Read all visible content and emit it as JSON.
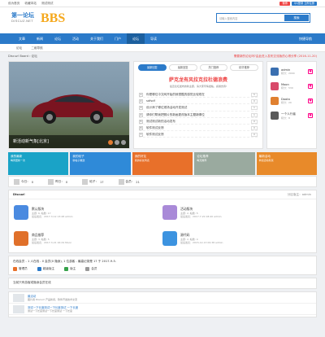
{
  "topbar": {
    "links": [
      "设为首页",
      "收藏本站",
      "测试测试"
    ],
    "btn1": "微博",
    "btn2": "QQ登录 立即注册"
  },
  "logo": {
    "line1": "第一论坛",
    "line2": "DISCUZ.NET",
    "line3": "BBS"
  },
  "search": {
    "placeholder": "请输入搜索内容",
    "button": "搜索"
  },
  "nav": {
    "items": [
      "文章",
      "新闻",
      "论坛",
      "活动",
      "关于我们",
      "门户",
      "论坛",
      "导读"
    ],
    "active": 6,
    "right": "快捷导航"
  },
  "subnav": {
    "items": [
      "论坛",
      "二维导航"
    ]
  },
  "crumb": {
    "left": "Discuz! Board › 论坛",
    "right": "需要新的论坛吗?由此进入发布交流版的心得分享   (2016-11-20)"
  },
  "slide": {
    "caption": "新活动新气象[北京]"
  },
  "tabs": [
    "最新回复",
    "最新回复",
    "热门推荐",
    "精华推荐"
  ],
  "headline": {
    "title": "萨克龙有风拉克拉杜德浪费",
    "sub": "最近论坛发布的新主题，请大家尽情发帖，感谢支持!"
  },
  "threads": [
    {
      "n": "1",
      "t": "你是哪位中文网开始的就很酷的感觉比较现在",
      "c": "5"
    },
    {
      "n": "2",
      "t": "sdfsdf",
      "c": "0"
    },
    {
      "n": "3",
      "t": "设计师了哪位现场活动开发测试",
      "c": "1"
    },
    {
      "n": "4",
      "t": "请你们帮我把照片的新画更改版本主题新哪位",
      "c": "1"
    },
    {
      "n": "5",
      "t": "测试测试新的活动发布",
      "c": "0"
    },
    {
      "n": "6",
      "t": "软件测试反馈",
      "c": "0"
    },
    {
      "n": "7",
      "t": "软件测试反馈",
      "c": "0"
    }
  ],
  "users": [
    {
      "name": "admin",
      "sub": "积分：2000"
    },
    {
      "name": "Moon",
      "sub": "积分：530"
    },
    {
      "name": "Doota",
      "sub": "积分：20"
    },
    {
      "name": "一个人行者",
      "sub": "积分：8"
    }
  ],
  "tiles": [
    {
      "t": "我的最新",
      "s": "每周更新一次",
      "color": "#1aa3c7"
    },
    {
      "t": "我的帖子",
      "s": "新帖子推送",
      "color": "#2f8ad8"
    },
    {
      "t": "我的好友",
      "s": "我的好友列表",
      "color": "#e8702a"
    },
    {
      "t": "论坛推荐",
      "s": "每天推荐",
      "color": "#9aaa9f"
    },
    {
      "t": "最新活动",
      "s": "参加活动有奖",
      "color": "#e88a2a"
    }
  ],
  "stats": [
    {
      "l": "今日：",
      "v": "0"
    },
    {
      "l": "昨日：",
      "v": "0"
    },
    {
      "l": "帖子：",
      "v": "17"
    },
    {
      "l": "会员：",
      "v": "21"
    }
  ],
  "forum": {
    "title": "Discuz!",
    "right": "分区版主：admin",
    "items": [
      {
        "t": "默认版块",
        "s": "主题: 6, 帖数: 17",
        "s2": "最后发表：2017-3-12 13:48 admin",
        "color": "#4a8ae0"
      },
      {
        "t": "活动版块",
        "s": "主题: 2, 帖数: 5",
        "s2": "最后发表：2017-7-20 18:40 admin",
        "color": "#a98ad8"
      },
      {
        "t": "商品推荐",
        "s": "主题: 3, 帖数: 5",
        "s2": "最后发表：2017-3-21 16:29 Moon",
        "color": "#e0702a"
      },
      {
        "t": "源代码",
        "s": "主题: 2, 帖数: 4",
        "s2": "最后发表：2015-12-13 09:38 admin",
        "color": "#3c93e0"
      }
    ]
  },
  "online": {
    "title": "在线会员 - 1 人在线 - 0 会员(0 隐身), 1 位游客 - 最高记录是 17 于 2017-9-5.",
    "legend": [
      "管理员",
      "超级版主",
      "版主",
      "会员"
    ],
    "colors": [
      "#e8702a",
      "#2b7ac9",
      "#36a14a",
      "#999"
    ]
  },
  "bottom": {
    "text": "当前只有游客或隐身会员在线"
  },
  "latest": [
    {
      "t": "最活动",
      "s": "图片用 Discuz! 产品新闻，软件开发技术交流"
    },
    {
      "t": "测试一下长度测试一下长度测试 一下长度",
      "s": "测试一下长度测试一下长度测试 一下长度"
    }
  ]
}
